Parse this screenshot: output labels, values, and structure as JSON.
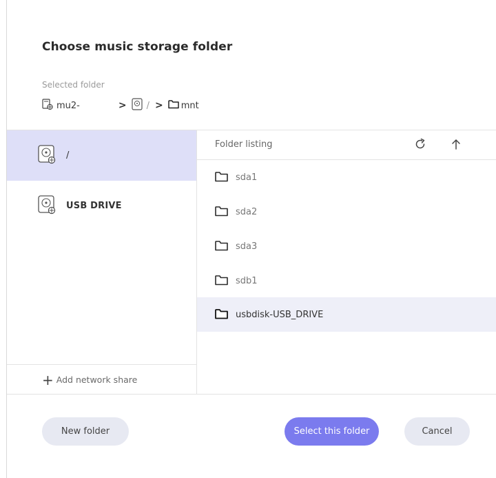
{
  "dialog": {
    "title": "Choose music storage folder",
    "selected_label": "Selected folder"
  },
  "breadcrumb": {
    "device_icon": "network-drive-icon",
    "device_name": "mu2-",
    "root_icon": "disk-icon",
    "root_label": "/",
    "separator": ">",
    "mnt_icon": "folder-icon",
    "mnt_label": "mnt"
  },
  "drives": [
    {
      "label": "/",
      "icon": "hard-drive-icon",
      "active": true
    },
    {
      "label": "USB DRIVE",
      "icon": "hard-drive-icon",
      "active": false
    }
  ],
  "add_share": {
    "icon": "plus-icon",
    "label": "Add network share"
  },
  "listing": {
    "title": "Folder listing",
    "refresh_icon": "refresh-icon",
    "up_icon": "arrow-up-icon",
    "folders": [
      {
        "name": "sda1",
        "selected": false
      },
      {
        "name": "sda2",
        "selected": false
      },
      {
        "name": "sda3",
        "selected": false
      },
      {
        "name": "sdb1",
        "selected": false
      },
      {
        "name": "usbdisk-USB_DRIVE",
        "selected": true
      }
    ]
  },
  "footer": {
    "new_folder_label": "New folder",
    "select_label": "Select this folder",
    "cancel_label": "Cancel"
  },
  "colors": {
    "accent": "#7b7bee",
    "active_drive_bg": "#dedff8",
    "selected_row_bg": "#eeeff8",
    "secondary_button_bg": "#e7e9f2"
  }
}
